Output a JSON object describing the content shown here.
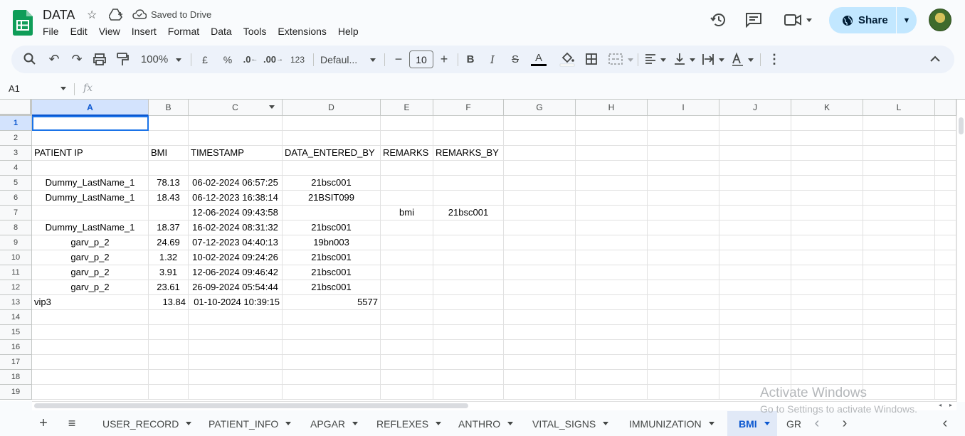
{
  "app": {
    "doc_title": "DATA",
    "save_status": "Saved to Drive",
    "menu": [
      "File",
      "Edit",
      "View",
      "Insert",
      "Format",
      "Data",
      "Tools",
      "Extensions",
      "Help"
    ],
    "share_label": "Share",
    "accent_color": "#0b57d0",
    "logo_color": "#0f9d58"
  },
  "toolbar": {
    "zoom": "100%",
    "currency": "£",
    "percent": "%",
    "dec_decrease": ".0",
    "dec_increase": ".00",
    "number_format": "123",
    "font": "Defaul...",
    "font_size": "10",
    "bold": "B",
    "italic": "I",
    "text_color_label": "A"
  },
  "formula_bar": {
    "name_box": "A1",
    "fx": "fx",
    "formula": ""
  },
  "grid": {
    "columns": [
      "A",
      "B",
      "C",
      "D",
      "E",
      "F",
      "G",
      "H",
      "I",
      "J",
      "K",
      "L"
    ],
    "selected_column": "A",
    "selected_row": "1",
    "rows": [
      {
        "n": "1",
        "cells": [
          "",
          "",
          "",
          "",
          "",
          ""
        ]
      },
      {
        "n": "2",
        "cells": [
          "",
          "",
          "",
          "",
          "",
          ""
        ]
      },
      {
        "n": "3",
        "cells": [
          "PATIENT IP",
          "BMI",
          "TIMESTAMP",
          "DATA_ENTERED_BY",
          "REMARKS",
          "REMARKS_BY"
        ]
      },
      {
        "n": "4",
        "cells": [
          "",
          "",
          "",
          "",
          "",
          ""
        ]
      },
      {
        "n": "5",
        "cells": [
          "Dummy_LastName_1",
          "78.13",
          "06-02-2024 06:57:25",
          "21bsc001",
          "",
          ""
        ]
      },
      {
        "n": "6",
        "cells": [
          "Dummy_LastName_1",
          "18.43",
          "06-12-2023 16:38:14",
          "21BSIT099",
          "",
          ""
        ]
      },
      {
        "n": "7",
        "cells": [
          "",
          "",
          "12-06-2024 09:43:58",
          "",
          "bmi",
          "21bsc001"
        ]
      },
      {
        "n": "8",
        "cells": [
          "Dummy_LastName_1",
          "18.37",
          "16-02-2024 08:31:32",
          "21bsc001",
          "",
          ""
        ]
      },
      {
        "n": "9",
        "cells": [
          "garv_p_2",
          "24.69",
          "07-12-2023 04:40:13",
          "19bn003",
          "",
          ""
        ]
      },
      {
        "n": "10",
        "cells": [
          "garv_p_2",
          "1.32",
          "10-02-2024 09:24:26",
          "21bsc001",
          "",
          ""
        ]
      },
      {
        "n": "11",
        "cells": [
          "garv_p_2",
          "3.91",
          "12-06-2024 09:46:42",
          "21bsc001",
          "",
          ""
        ]
      },
      {
        "n": "12",
        "cells": [
          "garv_p_2",
          "23.61",
          "26-09-2024 05:54:44",
          "21bsc001",
          "",
          ""
        ]
      },
      {
        "n": "13",
        "cells": [
          "vip3",
          "13.84",
          "01-10-2024 10:39:15",
          "5577",
          "",
          ""
        ]
      },
      {
        "n": "14",
        "cells": [
          "",
          "",
          "",
          "",
          "",
          ""
        ]
      },
      {
        "n": "15",
        "cells": [
          "",
          "",
          "",
          "",
          "",
          ""
        ]
      },
      {
        "n": "16",
        "cells": [
          "",
          "",
          "",
          "",
          "",
          ""
        ]
      },
      {
        "n": "17",
        "cells": [
          "",
          "",
          "",
          "",
          "",
          ""
        ]
      },
      {
        "n": "18",
        "cells": [
          "",
          "",
          "",
          "",
          "",
          ""
        ]
      },
      {
        "n": "19",
        "cells": [
          "",
          "",
          "",
          "",
          "",
          ""
        ]
      }
    ]
  },
  "sheets": {
    "tabs": [
      "USER_RECORD",
      "PATIENT_INFO",
      "APGAR",
      "REFLEXES",
      "ANTHRO",
      "VITAL_SIGNS",
      "IMMUNIZATION",
      "BMI",
      "GR"
    ],
    "active": "BMI"
  },
  "watermark": {
    "line1": "Activate Windows",
    "line2": "Go to Settings to activate Windows."
  }
}
